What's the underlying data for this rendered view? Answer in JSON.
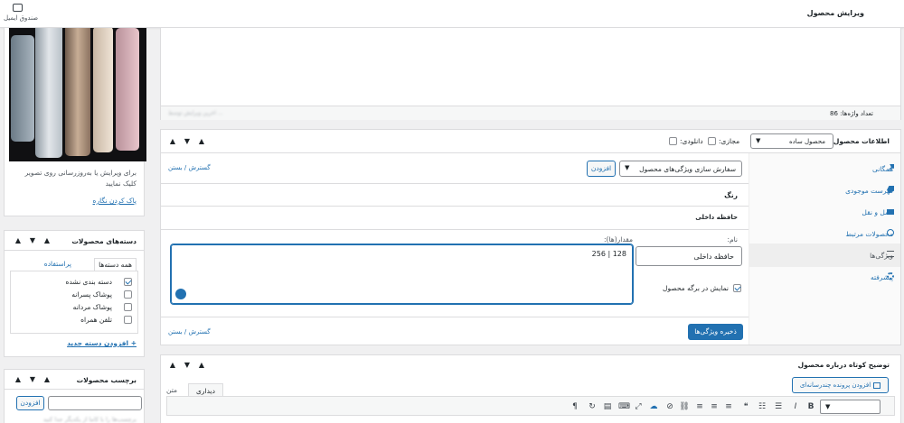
{
  "topbar": {
    "page_title": "ویرایش محصول",
    "inbox_label": "صندوق ایمیل"
  },
  "editor": {
    "word_count": "تعداد واژه‌ها: 86",
    "status_blur": "آخرین ویرایش توسط ..."
  },
  "image_box": {
    "caption": "برای ویرایش یا به‌روزرسانی روی تصویر کلیک نمایید",
    "remove_link": "پاک کردن نگاره"
  },
  "categories": {
    "title": "دسته‌های محصولات",
    "tab_all": "همه دسته‌ها",
    "tab_popular": "پراستفاده",
    "items": [
      {
        "label": "دسته بندی نشده",
        "checked": true
      },
      {
        "label": "پوشاک پسرانه",
        "checked": false
      },
      {
        "label": "پوشاک مردانه",
        "checked": false
      },
      {
        "label": "تلفن همراه",
        "checked": false
      }
    ],
    "add_link": "+ افزودن دسته جدید"
  },
  "tags": {
    "title": "برچسب محصولات",
    "add_button": "افزودن",
    "hint": "برچسب‌ها را با کاما از یکدیگر جدا کنید"
  },
  "product_data": {
    "title": "اطلاعات محصول —",
    "type_value": "محصول ساده",
    "virtual_label": "مجازی:",
    "download_label": "دانلودی:",
    "tabs": [
      {
        "label": "همگانی",
        "icon": "wrench-icon",
        "active": false
      },
      {
        "label": "فهرست موجودی",
        "icon": "tag-icon",
        "active": false
      },
      {
        "label": "حمل و نقل",
        "icon": "truck-icon",
        "active": false
      },
      {
        "label": "محصولات مرتبط",
        "icon": "link-icon",
        "active": false
      },
      {
        "label": "ویژگی‌ها",
        "icon": "list-icon",
        "active": true
      },
      {
        "label": "پیشرفته",
        "icon": "gear-icon",
        "active": false
      }
    ],
    "attributes": {
      "select_value": "سفارش سازی ویژگی‌های محصول",
      "add_button": "افزودن",
      "expand_close": "گسترش / بستن",
      "attr1_name": "رنگ",
      "attr2_name": "حافظه داخلی",
      "name_label": "نام:",
      "name_value": "حافظه داخلی",
      "values_label": "مقدار(ها):",
      "values_value": "128 | 256",
      "visible_label": "نمایش در برگه محصول",
      "save_button": "ذخیره ویژگی‌ها"
    }
  },
  "short_desc": {
    "title": "توضیح کوتاه درباره محصول",
    "add_media": "افزودن پرونده چندرسانه‌ای",
    "tab_visual": "دیداری",
    "tab_text": "متن",
    "bold_label": "B",
    "italic_label": "I"
  }
}
